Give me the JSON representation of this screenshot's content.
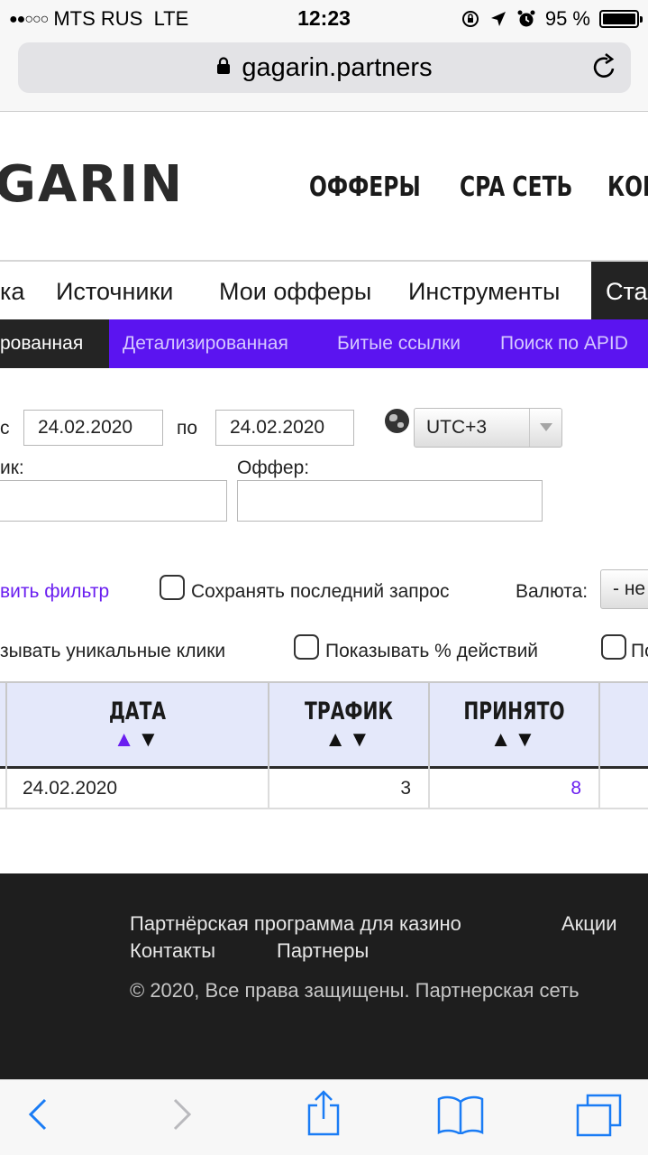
{
  "status_bar": {
    "signal_dots": "●●○○○",
    "carrier": "MTS RUS",
    "network": "LTE",
    "time": "12:23",
    "battery_percent": "95 %",
    "battery_level": 0.95,
    "icons": [
      "orientation-lock-icon",
      "location-arrow-icon",
      "alarm-icon"
    ]
  },
  "browser": {
    "url": "gagarin.partners",
    "lock_icon": "lock-icon",
    "reload_icon": "reload-icon"
  },
  "site_header": {
    "logo": "GARIN",
    "nav": [
      "ОФФЕРЫ",
      "CPA СЕТЬ",
      "КОН"
    ]
  },
  "tabs": {
    "items": [
      "ка",
      "Источники",
      "Мои офферы",
      "Инструменты"
    ],
    "active": "Ста"
  },
  "subnav": {
    "active": "рованная",
    "items": [
      "Детализированная",
      "Битые ссылки",
      "Поиск по APID"
    ]
  },
  "filters": {
    "from_label": "с",
    "from_value": "24.02.2020",
    "to_label": "по",
    "to_value": "24.02.2020",
    "timezone": "UTC+3",
    "source_label": "ик:",
    "source_value": "",
    "offer_label": "Оффер:",
    "offer_value": "",
    "add_filter_link": "вить фильтр",
    "save_last_query": "Сохранять последний запрос",
    "currency_label": "Валюта:",
    "currency_value": "- не",
    "unique_clicks": "зывать уникальные клики",
    "show_percent": "Показывать % действий",
    "third_option": "По"
  },
  "table": {
    "columns": [
      {
        "label": "ДАТА",
        "sort": "▲▼",
        "active": "asc"
      },
      {
        "label": "ТРАФИК",
        "sort": "▲▼"
      },
      {
        "label": "ПРИНЯТО",
        "sort": "▲▼"
      }
    ],
    "rows": [
      {
        "date": "24.02.2020",
        "traffic": "3",
        "accepted": "8"
      }
    ]
  },
  "footer": {
    "links": [
      "Партнёрская программа для казино",
      "Акции",
      "Контакты",
      "Партнеры"
    ],
    "copyright": "© 2020, Все права защищены. Партнерская сеть"
  },
  "toolbar": {
    "buttons": [
      "back-icon",
      "forward-icon",
      "share-icon",
      "bookmarks-icon",
      "tabs-icon"
    ]
  },
  "colors": {
    "accent_purple": "#5b14f0",
    "link_purple": "#6a1ef0",
    "dark": "#232323",
    "ios_blue": "#1a7cf5"
  }
}
